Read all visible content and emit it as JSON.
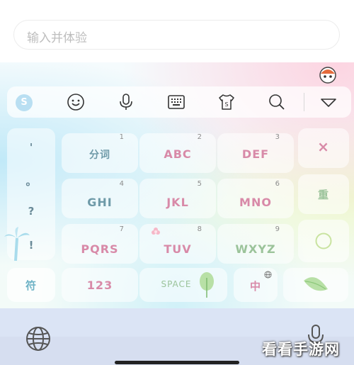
{
  "search": {
    "placeholder": "输入并体验"
  },
  "toolbar": {
    "logo_letter": "S",
    "icons": [
      "emoji-icon",
      "microphone-icon",
      "keyboard-icon",
      "skin-icon",
      "search-icon",
      "collapse-icon"
    ]
  },
  "keys": {
    "punct": [
      "'",
      "。",
      "?",
      "!"
    ],
    "row1": [
      {
        "label": "分词",
        "num": "1"
      },
      {
        "label": "ABC",
        "num": "2"
      },
      {
        "label": "DEF",
        "num": "3"
      }
    ],
    "row2": [
      {
        "label": "GHI",
        "num": "4"
      },
      {
        "label": "JKL",
        "num": "5"
      },
      {
        "label": "MNO",
        "num": "6"
      }
    ],
    "row3": [
      {
        "label": "PQRS",
        "num": "7"
      },
      {
        "label": "TUV",
        "num": "8"
      },
      {
        "label": "WXYZ",
        "num": "9"
      }
    ],
    "delete": "×",
    "reenter": "重",
    "symbol": "符",
    "numbers": "123",
    "space": "SPACE",
    "lang": "中"
  },
  "watermark": "看看手游网",
  "colors": {
    "pink_text": "#d88aa8",
    "green_text": "#9bc39a",
    "blue_text": "#6e9aa8",
    "accent_teal": "#6fb3c6"
  }
}
